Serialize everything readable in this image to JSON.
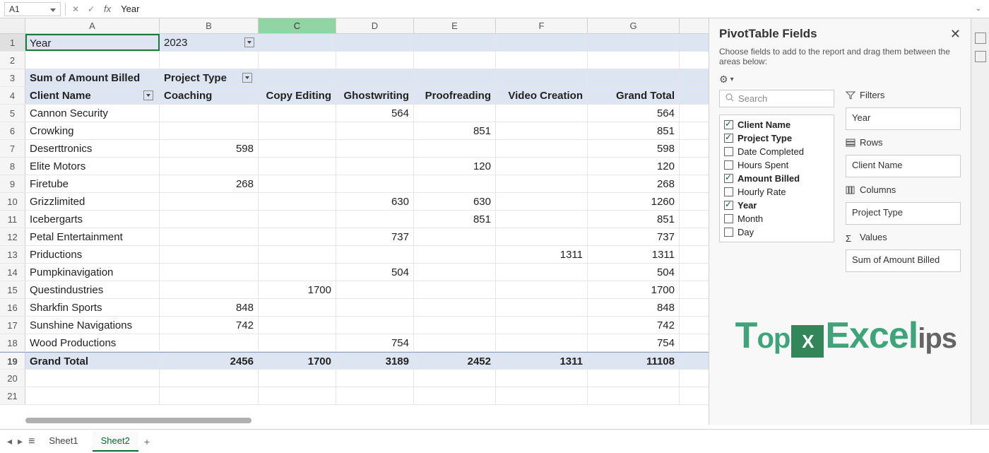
{
  "formula_bar": {
    "name_box": "A1",
    "value": "Year"
  },
  "columns": [
    "A",
    "B",
    "C",
    "D",
    "E",
    "F",
    "G"
  ],
  "row1": {
    "a": "Year",
    "b": "2023"
  },
  "row3": {
    "a": "Sum of Amount Billed",
    "b": "Project Type"
  },
  "row4": {
    "a": "Client Name",
    "b": "Coaching",
    "c": "Copy Editing",
    "d": "Ghostwriting",
    "e": "Proofreading",
    "f": "Video Creation",
    "g": "Grand Total"
  },
  "data_rows": [
    {
      "r": 5,
      "a": "Cannon Security",
      "b": "",
      "c": "",
      "d": "564",
      "e": "",
      "f": "",
      "g": "564"
    },
    {
      "r": 6,
      "a": "Crowking",
      "b": "",
      "c": "",
      "d": "",
      "e": "851",
      "f": "",
      "g": "851"
    },
    {
      "r": 7,
      "a": "Deserttronics",
      "b": "598",
      "c": "",
      "d": "",
      "e": "",
      "f": "",
      "g": "598"
    },
    {
      "r": 8,
      "a": "Elite Motors",
      "b": "",
      "c": "",
      "d": "",
      "e": "120",
      "f": "",
      "g": "120"
    },
    {
      "r": 9,
      "a": "Firetube",
      "b": "268",
      "c": "",
      "d": "",
      "e": "",
      "f": "",
      "g": "268"
    },
    {
      "r": 10,
      "a": "Grizzlimited",
      "b": "",
      "c": "",
      "d": "630",
      "e": "630",
      "f": "",
      "g": "1260"
    },
    {
      "r": 11,
      "a": "Icebergarts",
      "b": "",
      "c": "",
      "d": "",
      "e": "851",
      "f": "",
      "g": "851"
    },
    {
      "r": 12,
      "a": "Petal Entertainment",
      "b": "",
      "c": "",
      "d": "737",
      "e": "",
      "f": "",
      "g": "737"
    },
    {
      "r": 13,
      "a": "Priductions",
      "b": "",
      "c": "",
      "d": "",
      "e": "",
      "f": "1311",
      "g": "1311"
    },
    {
      "r": 14,
      "a": "Pumpkinavigation",
      "b": "",
      "c": "",
      "d": "504",
      "e": "",
      "f": "",
      "g": "504"
    },
    {
      "r": 15,
      "a": "Questindustries",
      "b": "",
      "c": "1700",
      "d": "",
      "e": "",
      "f": "",
      "g": "1700"
    },
    {
      "r": 16,
      "a": "Sharkfin Sports",
      "b": "848",
      "c": "",
      "d": "",
      "e": "",
      "f": "",
      "g": "848"
    },
    {
      "r": 17,
      "a": "Sunshine Navigations",
      "b": "742",
      "c": "",
      "d": "",
      "e": "",
      "f": "",
      "g": "742"
    },
    {
      "r": 18,
      "a": "Wood Productions",
      "b": "",
      "c": "",
      "d": "754",
      "e": "",
      "f": "",
      "g": "754"
    }
  ],
  "grand_total": {
    "r": 19,
    "a": "Grand Total",
    "b": "2456",
    "c": "1700",
    "d": "3189",
    "e": "2452",
    "f": "1311",
    "g": "11108"
  },
  "empty_rows": [
    20,
    21
  ],
  "pane": {
    "title": "PivotTable Fields",
    "subtitle": "Choose fields to add to the report and drag them between the areas below:",
    "search_placeholder": "Search",
    "fields": [
      {
        "label": "Client Name",
        "checked": true
      },
      {
        "label": "Project Type",
        "checked": true
      },
      {
        "label": "Date Completed",
        "checked": false
      },
      {
        "label": "Hours Spent",
        "checked": false
      },
      {
        "label": "Amount Billed",
        "checked": true
      },
      {
        "label": "Hourly Rate",
        "checked": false
      },
      {
        "label": "Year",
        "checked": true
      },
      {
        "label": "Month",
        "checked": false
      },
      {
        "label": "Day",
        "checked": false
      }
    ],
    "filters_label": "Filters",
    "filters_value": "Year",
    "rows_label": "Rows",
    "rows_value": "Client Name",
    "columns_label": "Columns",
    "columns_value": "Project Type",
    "values_label": "Values",
    "values_value": "Sum of Amount Billed"
  },
  "tabs": {
    "sheet1": "Sheet1",
    "sheet2": "Sheet2"
  },
  "watermark": {
    "t1": "T",
    "t2": "op",
    "xl": "X",
    "t3": "Excel",
    "t4": "ips"
  }
}
